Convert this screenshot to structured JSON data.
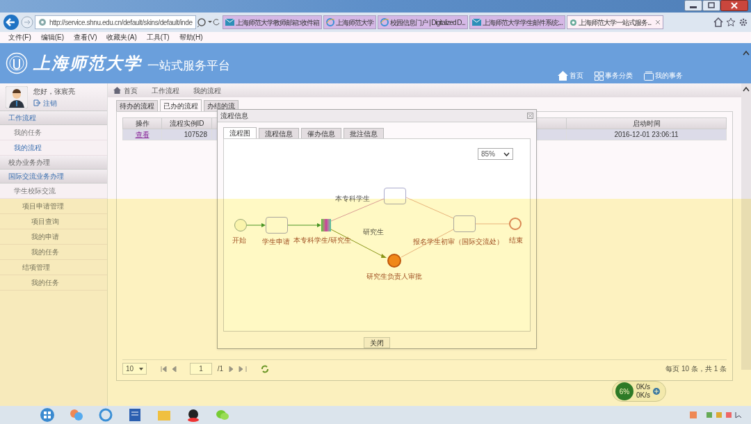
{
  "browser": {
    "url": "http://service.shnu.edu.cn/default/skins/default/inde",
    "tabs": [
      {
        "title": "上海师范大学教师邮箱::收件箱",
        "kind": "mail",
        "selected": false
      },
      {
        "title": "上海师范大学",
        "kind": "ie",
        "selected": false
      },
      {
        "title": "校园信息门户 | Digitalized D...",
        "kind": "ie",
        "selected": false
      },
      {
        "title": "上海师范大学学生邮件系统:...",
        "kind": "mail",
        "selected": false
      },
      {
        "title": "上海师范大学一站式服务...",
        "kind": "site",
        "selected": true
      }
    ],
    "menu": [
      "文件(F)",
      "编辑(E)",
      "查看(V)",
      "收藏夹(A)",
      "工具(T)",
      "帮助(H)"
    ]
  },
  "header": {
    "logo": "上海师范大学",
    "title": "一站式服务平台",
    "nav": [
      {
        "label": "首页",
        "kind": "home"
      },
      {
        "label": "事务分类",
        "kind": "grid"
      },
      {
        "label": "我的事务",
        "kind": "box"
      }
    ]
  },
  "user": {
    "greeting": "您好，张宸亮",
    "logout": "注销"
  },
  "sidebar": [
    {
      "label": "工作流程",
      "kind": "section",
      "selected": true,
      "children": [
        {
          "label": "我的任务",
          "selected": false
        },
        {
          "label": "我的流程",
          "selected": true
        }
      ]
    },
    {
      "label": "校办业务办理",
      "kind": "section",
      "selected": false
    },
    {
      "label": "国际交流业务办理",
      "kind": "section",
      "selected": true,
      "children": [
        {
          "label": "学生校际交流",
          "selected": false,
          "children": [
            {
              "label": "项目申请管理",
              "selected": false,
              "children": [
                {
                  "label": "项目查询",
                  "selected": false
                },
                {
                  "label": "我的申请",
                  "selected": false
                },
                {
                  "label": "我的任务",
                  "selected": false
                }
              ]
            },
            {
              "label": "结项管理",
              "selected": false,
              "children": [
                {
                  "label": "我的任务",
                  "selected": false
                }
              ]
            }
          ]
        }
      ]
    }
  ],
  "breadcrumb": [
    "首页",
    "工作流程",
    "我的流程"
  ],
  "tabs": [
    {
      "label": "待办的流程",
      "selected": false
    },
    {
      "label": "已办的流程",
      "selected": true
    },
    {
      "label": "办结的流",
      "selected": false
    }
  ],
  "table": {
    "columns": [
      "操作",
      "流程实例ID",
      "启动时间"
    ],
    "rows": [
      {
        "action": "查看",
        "id": "107528",
        "start": "2016-12-01 23:06:11",
        "selected": true
      }
    ]
  },
  "pager": {
    "page_size": "10",
    "page": "1",
    "total": "/1",
    "summary": "每页 10 条，共 1 条"
  },
  "dialog": {
    "title": "流程信息",
    "tabs": [
      {
        "label": "流程图",
        "selected": true
      },
      {
        "label": "流程信息",
        "selected": false
      },
      {
        "label": "催办信息",
        "selected": false
      },
      {
        "label": "批注信息",
        "selected": false
      }
    ],
    "zoom": "85%",
    "close": "关闭",
    "diagram": {
      "nodes": [
        {
          "kind": "start",
          "label": "开始"
        },
        {
          "kind": "task",
          "label": "学生申请"
        },
        {
          "kind": "gateway",
          "label": "本专科学生/研究生"
        },
        {
          "kind": "task"
        },
        {
          "kind": "active",
          "label": "研究生负责人审批"
        },
        {
          "kind": "task",
          "label": "报名学生初审（国际交流处）"
        },
        {
          "kind": "end",
          "label": "结束"
        }
      ],
      "edge_labels": [
        "本专科学生",
        "研究生"
      ]
    }
  },
  "tray": {
    "percent": "6%",
    "up": "0K/s",
    "down": "0K/s"
  }
}
